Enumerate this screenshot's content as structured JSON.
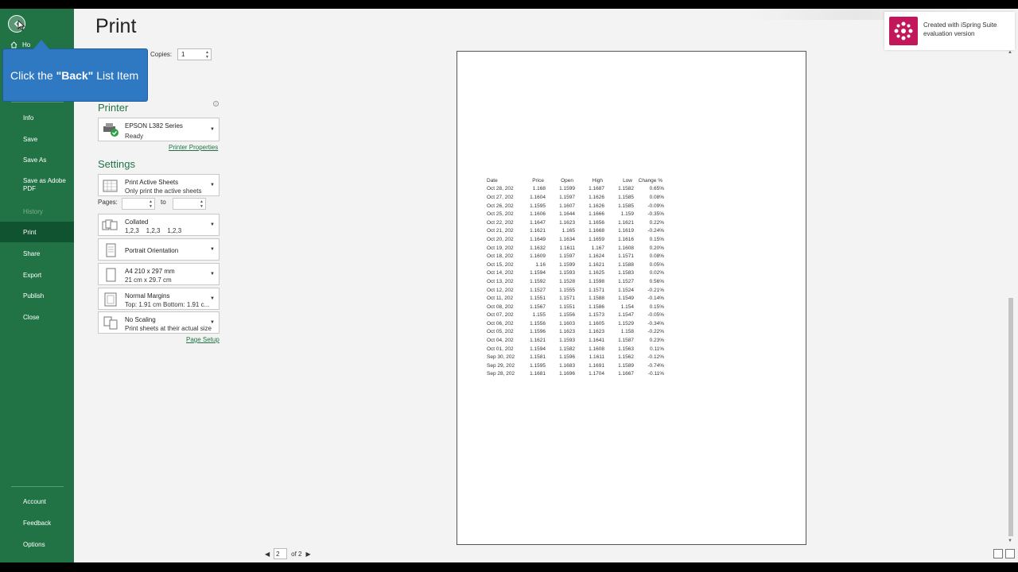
{
  "app": {
    "title": "Print"
  },
  "sidebar": {
    "home_label": "Ho",
    "items": [
      {
        "label": "Info"
      },
      {
        "label": "Save"
      },
      {
        "label": "Save As"
      },
      {
        "label": "Save as Adobe PDF"
      },
      {
        "label": "History"
      },
      {
        "label": "Print"
      },
      {
        "label": "Share"
      },
      {
        "label": "Export"
      },
      {
        "label": "Publish"
      },
      {
        "label": "Close"
      }
    ],
    "bottom_items": [
      {
        "label": "Account"
      },
      {
        "label": "Feedback"
      },
      {
        "label": "Options"
      }
    ]
  },
  "print": {
    "copies_label": "Copies:",
    "copies_value": "1",
    "printer_heading": "Printer",
    "printer_name": "EPSON L382 Series",
    "printer_status": "Ready",
    "printer_properties_link": "Printer Properties",
    "settings_heading": "Settings",
    "settings": [
      {
        "line1": "Print Active Sheets",
        "line2": "Only print the active sheets"
      },
      {
        "line1": "Collated",
        "line2": "1,2,3    1,2,3    1,2,3"
      },
      {
        "line1": "Portrait Orientation",
        "line2": ""
      },
      {
        "line1": "A4 210 x 297 mm",
        "line2": "21 cm x 29.7 cm"
      },
      {
        "line1": "Normal Margins",
        "line2": "Top: 1.91 cm Bottom: 1.91 c..."
      },
      {
        "line1": "No Scaling",
        "line2": "Print sheets at their actual size"
      }
    ],
    "pages_label": "Pages:",
    "to_label": "to",
    "page_setup_link": "Page Setup"
  },
  "pager": {
    "current": "2",
    "of_label": "of 2"
  },
  "sheet": {
    "headers": [
      "Date",
      "Price",
      "Open",
      "High",
      "Low",
      "Change %"
    ],
    "rows": [
      [
        "Oct 28, 202",
        "1.168",
        "1.1599",
        "1.1687",
        "1.1582",
        "0.65%"
      ],
      [
        "Oct 27, 202",
        "1.1604",
        "1.1597",
        "1.1626",
        "1.1585",
        "0.08%"
      ],
      [
        "Oct 26, 202",
        "1.1595",
        "1.1607",
        "1.1626",
        "1.1585",
        "-0.09%"
      ],
      [
        "Oct 25, 202",
        "1.1606",
        "1.1644",
        "1.1666",
        "1.159",
        "-0.35%"
      ],
      [
        "Oct 22, 202",
        "1.1647",
        "1.1623",
        "1.1656",
        "1.1621",
        "0.22%"
      ],
      [
        "Oct 21, 202",
        "1.1621",
        "1.165",
        "1.1668",
        "1.1619",
        "-0.24%"
      ],
      [
        "Oct 20, 202",
        "1.1649",
        "1.1634",
        "1.1659",
        "1.1616",
        "0.15%"
      ],
      [
        "Oct 19, 202",
        "1.1632",
        "1.1611",
        "1.167",
        "1.1608",
        "0.20%"
      ],
      [
        "Oct 18, 202",
        "1.1609",
        "1.1597",
        "1.1624",
        "1.1571",
        "0.08%"
      ],
      [
        "Oct 15, 202",
        "1.16",
        "1.1599",
        "1.1621",
        "1.1588",
        "0.05%"
      ],
      [
        "Oct 14, 202",
        "1.1594",
        "1.1593",
        "1.1625",
        "1.1583",
        "0.02%"
      ],
      [
        "Oct 13, 202",
        "1.1592",
        "1.1528",
        "1.1598",
        "1.1527",
        "0.56%"
      ],
      [
        "Oct 12, 202",
        "1.1527",
        "1.1555",
        "1.1571",
        "1.1524",
        "-0.21%"
      ],
      [
        "Oct 11, 202",
        "1.1551",
        "1.1571",
        "1.1588",
        "1.1549",
        "-0.14%"
      ],
      [
        "Oct 08, 202",
        "1.1567",
        "1.1551",
        "1.1586",
        "1.154",
        "0.15%"
      ],
      [
        "Oct 07, 202",
        "1.155",
        "1.1556",
        "1.1573",
        "1.1547",
        "-0.05%"
      ],
      [
        "Oct 06, 202",
        "1.1556",
        "1.1603",
        "1.1605",
        "1.1529",
        "-0.34%"
      ],
      [
        "Oct 05, 202",
        "1.1596",
        "1.1623",
        "1.1623",
        "1.158",
        "-0.22%"
      ],
      [
        "Oct 04, 202",
        "1.1621",
        "1.1593",
        "1.1641",
        "1.1587",
        "0.23%"
      ],
      [
        "Oct 01, 202",
        "1.1594",
        "1.1582",
        "1.1608",
        "1.1563",
        "0.11%"
      ],
      [
        "Sep 30, 202",
        "1.1581",
        "1.1596",
        "1.1611",
        "1.1562",
        "-0.12%"
      ],
      [
        "Sep 29, 202",
        "1.1595",
        "1.1683",
        "1.1691",
        "1.1589",
        "-0.74%"
      ],
      [
        "Sep 28, 202",
        "1.1681",
        "1.1696",
        "1.1704",
        "1.1667",
        "-0.11%"
      ]
    ]
  },
  "badge": {
    "line1": "Created with iSpring Suite",
    "line2": "evaluation version"
  },
  "callout": {
    "prefix": "Click the ",
    "bold": "\"Back\"",
    "suffix": " List Item"
  },
  "colors": {
    "accent": "#217346",
    "sidebar_active": "#0f5330",
    "callout": "#2f78c2",
    "badge_logo": "#c2185b"
  }
}
